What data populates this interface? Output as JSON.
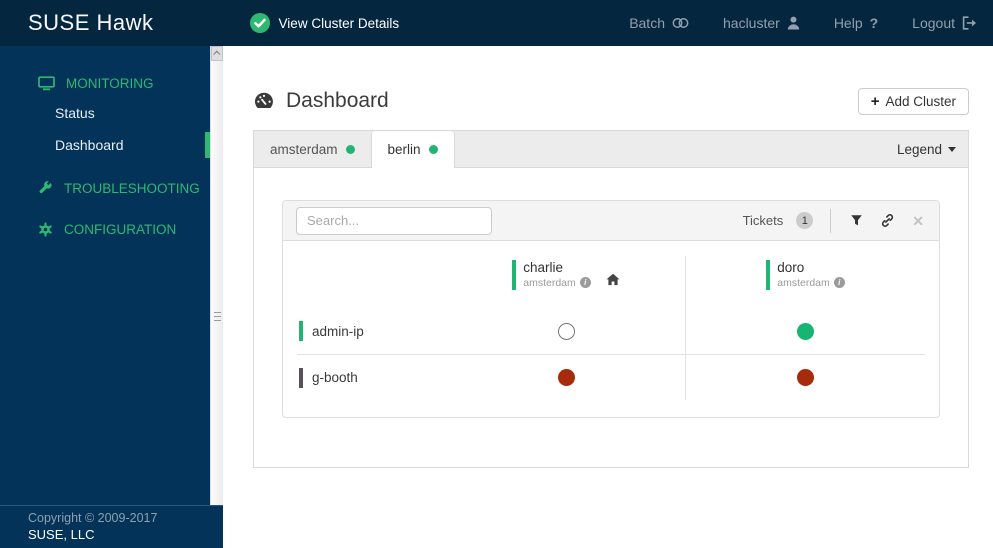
{
  "colors": {
    "navbar_bg": "#05263f",
    "sidebar_bg": "#033358",
    "accent_green": "#2eb872",
    "status_green": "#21b573",
    "status_failed_red": "#a52b0b"
  },
  "icons": {
    "question": "?",
    "close": "✕",
    "plus": "+",
    "info": "i"
  },
  "navbar": {
    "brand": "SUSE Hawk",
    "cluster_status": "View Cluster Details",
    "menu": [
      {
        "label": "Batch",
        "icon": "batch-icon"
      },
      {
        "label": "hacluster",
        "icon": "user-icon"
      },
      {
        "label": "Help",
        "icon": "question-icon"
      },
      {
        "label": "Logout",
        "icon": "logout-icon"
      }
    ]
  },
  "sidebar": {
    "sections": [
      {
        "label": "MONITORING",
        "icon": "monitor-icon",
        "items": [
          {
            "label": "Status",
            "active": false
          },
          {
            "label": "Dashboard",
            "active": true
          }
        ]
      },
      {
        "label": "TROUBLESHOOTING",
        "icon": "wrench-icon",
        "items": []
      },
      {
        "label": "CONFIGURATION",
        "icon": "gear-icon",
        "items": []
      }
    ],
    "footer": {
      "copyright": "Copyright © 2009-2017",
      "company": "SUSE, LLC"
    }
  },
  "main": {
    "title": "Dashboard",
    "add_cluster_label": "Add Cluster",
    "legend_label": "Legend",
    "tabs": [
      {
        "label": "amsterdam",
        "status": "ok",
        "active": false
      },
      {
        "label": "berlin",
        "status": "ok",
        "active": true
      }
    ]
  },
  "panel": {
    "search_placeholder": "Search...",
    "tickets_label": "Tickets",
    "tickets_count": "1"
  },
  "dashboard_table": {
    "columns": [
      {
        "name": "charlie",
        "cluster": "amsterdam",
        "home": true
      },
      {
        "name": "doro",
        "cluster": "amsterdam",
        "home": false
      }
    ],
    "rows": [
      {
        "label": "admin-ip",
        "bar": "ok",
        "cells": [
          "empty",
          "ok"
        ]
      },
      {
        "label": "g-booth",
        "bar": "stopped",
        "cells": [
          "failed",
          "failed"
        ]
      }
    ]
  }
}
